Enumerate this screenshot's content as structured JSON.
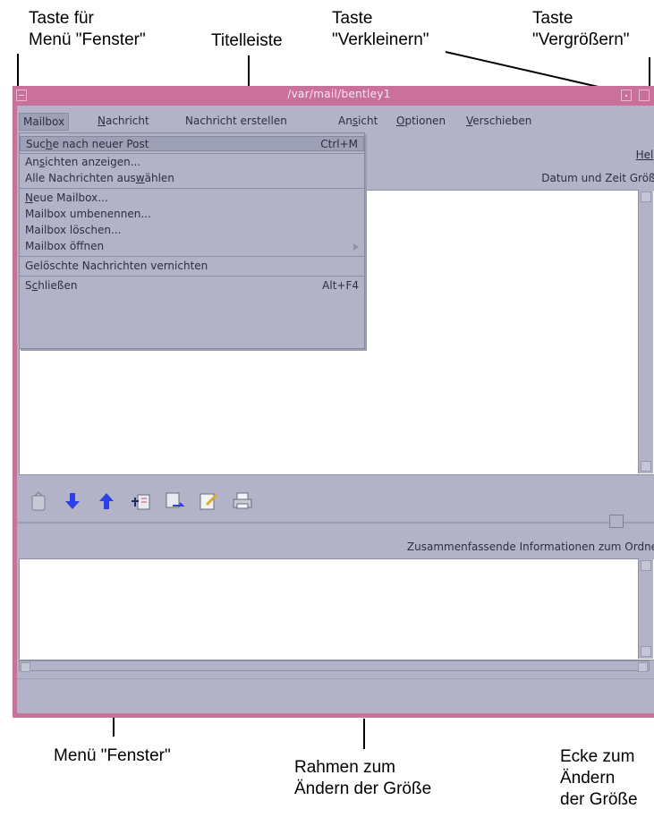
{
  "callouts": {
    "window_menu_button": [
      "Taste für",
      "Menü \"Fenster\""
    ],
    "titlebar": [
      "Titelleiste"
    ],
    "minimize_button": [
      "Taste",
      "\"Verkleinern\""
    ],
    "maximize_button": [
      "Taste",
      "\"Vergrößern\""
    ],
    "window_menu": [
      "Menü \"Fenster\""
    ],
    "resize_border": [
      "Rahmen zum",
      "Ändern der Größe"
    ],
    "resize_corner": [
      "Ecke zum",
      "Ändern",
      "der Größe"
    ]
  },
  "window": {
    "title": "/var/mail/bentley1",
    "menubar": [
      {
        "label": "Mailbox",
        "mnemonic": ""
      },
      {
        "label": "Nachricht",
        "mnemonic": "N"
      },
      {
        "label": "Nachricht erstellen",
        "mnemonic": ""
      },
      {
        "label": "Ansicht",
        "mnemonic": "s"
      },
      {
        "label": "Optionen",
        "mnemonic": "O"
      },
      {
        "label": "Verschieben",
        "mnemonic": "V"
      }
    ],
    "help": "Help",
    "list_header": "Datum und Zeit Größe",
    "summary_label": "Zusammenfassende Informationen zum Ordner"
  },
  "mailbox_menu": {
    "items": [
      {
        "label": "Suche nach neuer Post",
        "accelerator": "Ctrl+M",
        "highlighted": true
      },
      {
        "label": "Ansichten anzeigen...",
        "accelerator": ""
      },
      {
        "label": "Alle Nachrichten auswählen",
        "accelerator": ""
      },
      {
        "label": "Neue Mailbox...",
        "accelerator": ""
      },
      {
        "label": "Mailbox umbenennen...",
        "accelerator": ""
      },
      {
        "label": "Mailbox löschen...",
        "accelerator": ""
      },
      {
        "label": "Mailbox öffnen",
        "accelerator": "",
        "cascade": true
      },
      {
        "label": "Gelöschte Nachrichten vernichten",
        "accelerator": ""
      },
      {
        "label": "Schließen",
        "accelerator": "Alt+F4"
      }
    ]
  },
  "toolbar_icons": [
    "delete-icon",
    "next-message-icon",
    "previous-message-icon",
    "reply-icon",
    "forward-icon",
    "compose-icon",
    "print-icon"
  ],
  "colors": {
    "window_frame": "#c9709b",
    "client_bg": "#b2b3c7",
    "pane_bg": "#ffffff",
    "menu_highlight": "#9ea0b5",
    "arrow_blue": "#2f3fe8"
  }
}
